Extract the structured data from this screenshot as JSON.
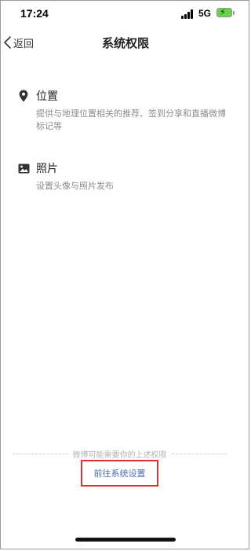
{
  "status_bar": {
    "time": "17:24",
    "network": "5G",
    "battery": "charging"
  },
  "nav": {
    "back_label": "返回",
    "title": "系统权限"
  },
  "permissions": [
    {
      "icon": "location-pin-icon",
      "title": "位置",
      "description": "提供与地理位置相关的推荐、签到分享和直播微博标记等"
    },
    {
      "icon": "photo-icon",
      "title": "照片",
      "description": "设置头像与照片发布"
    }
  ],
  "footer": {
    "note": "微博可能需要你的上述权限",
    "button_label": "前往系统设置",
    "highlight_color": "#e0302c",
    "link_color": "#4a6fb0"
  }
}
